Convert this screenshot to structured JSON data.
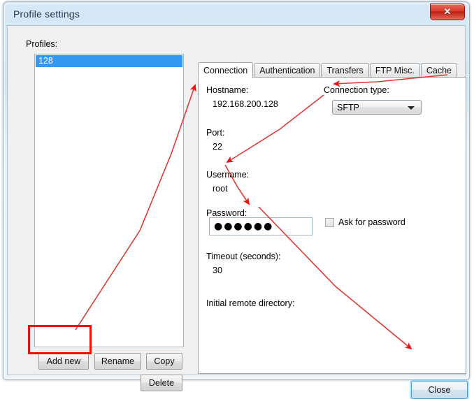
{
  "window": {
    "title": "Profile settings",
    "close_button_icon": "close-x-icon",
    "close_button_label": "✕"
  },
  "left_panel": {
    "profiles_label": "Profiles:",
    "profiles": [
      {
        "name": "128",
        "selected": true
      }
    ],
    "buttons": {
      "add_new": "Add new",
      "rename": "Rename",
      "copy": "Copy",
      "delete": "Delete"
    }
  },
  "tabs": [
    {
      "label": "Connection",
      "active": true
    },
    {
      "label": "Authentication",
      "active": false
    },
    {
      "label": "Transfers",
      "active": false
    },
    {
      "label": "FTP Misc.",
      "active": false
    },
    {
      "label": "Cache",
      "active": false
    }
  ],
  "connection_tab": {
    "hostname_label": "Hostname:",
    "hostname_value": "192.168.200.128",
    "connection_type_label": "Connection type:",
    "connection_type_value": "SFTP",
    "port_label": "Port:",
    "port_value": "22",
    "username_label": "Username:",
    "username_value": "root",
    "password_label": "Password:",
    "password_masked": "●●●●●●",
    "ask_for_password_label": "Ask for password",
    "ask_for_password_checked": false,
    "timeout_label": "Timeout (seconds):",
    "timeout_value": "30",
    "initial_remote_directory_label": "Initial remote directory:",
    "initial_remote_directory_value": ""
  },
  "footer": {
    "close_label": "Close"
  },
  "annotations": {
    "highlight_color": "#ee1111",
    "highlight_target": "Add new",
    "arrows": [
      {
        "from": "add-new-button",
        "to": "hostname-value"
      },
      {
        "from": "hostname-value",
        "to": "connection-type-combo"
      },
      {
        "from": "connection-type-combo",
        "to": "username-value"
      },
      {
        "from": "username-value",
        "to": "password-field"
      },
      {
        "from": "password-field",
        "to": "close-button"
      }
    ]
  }
}
